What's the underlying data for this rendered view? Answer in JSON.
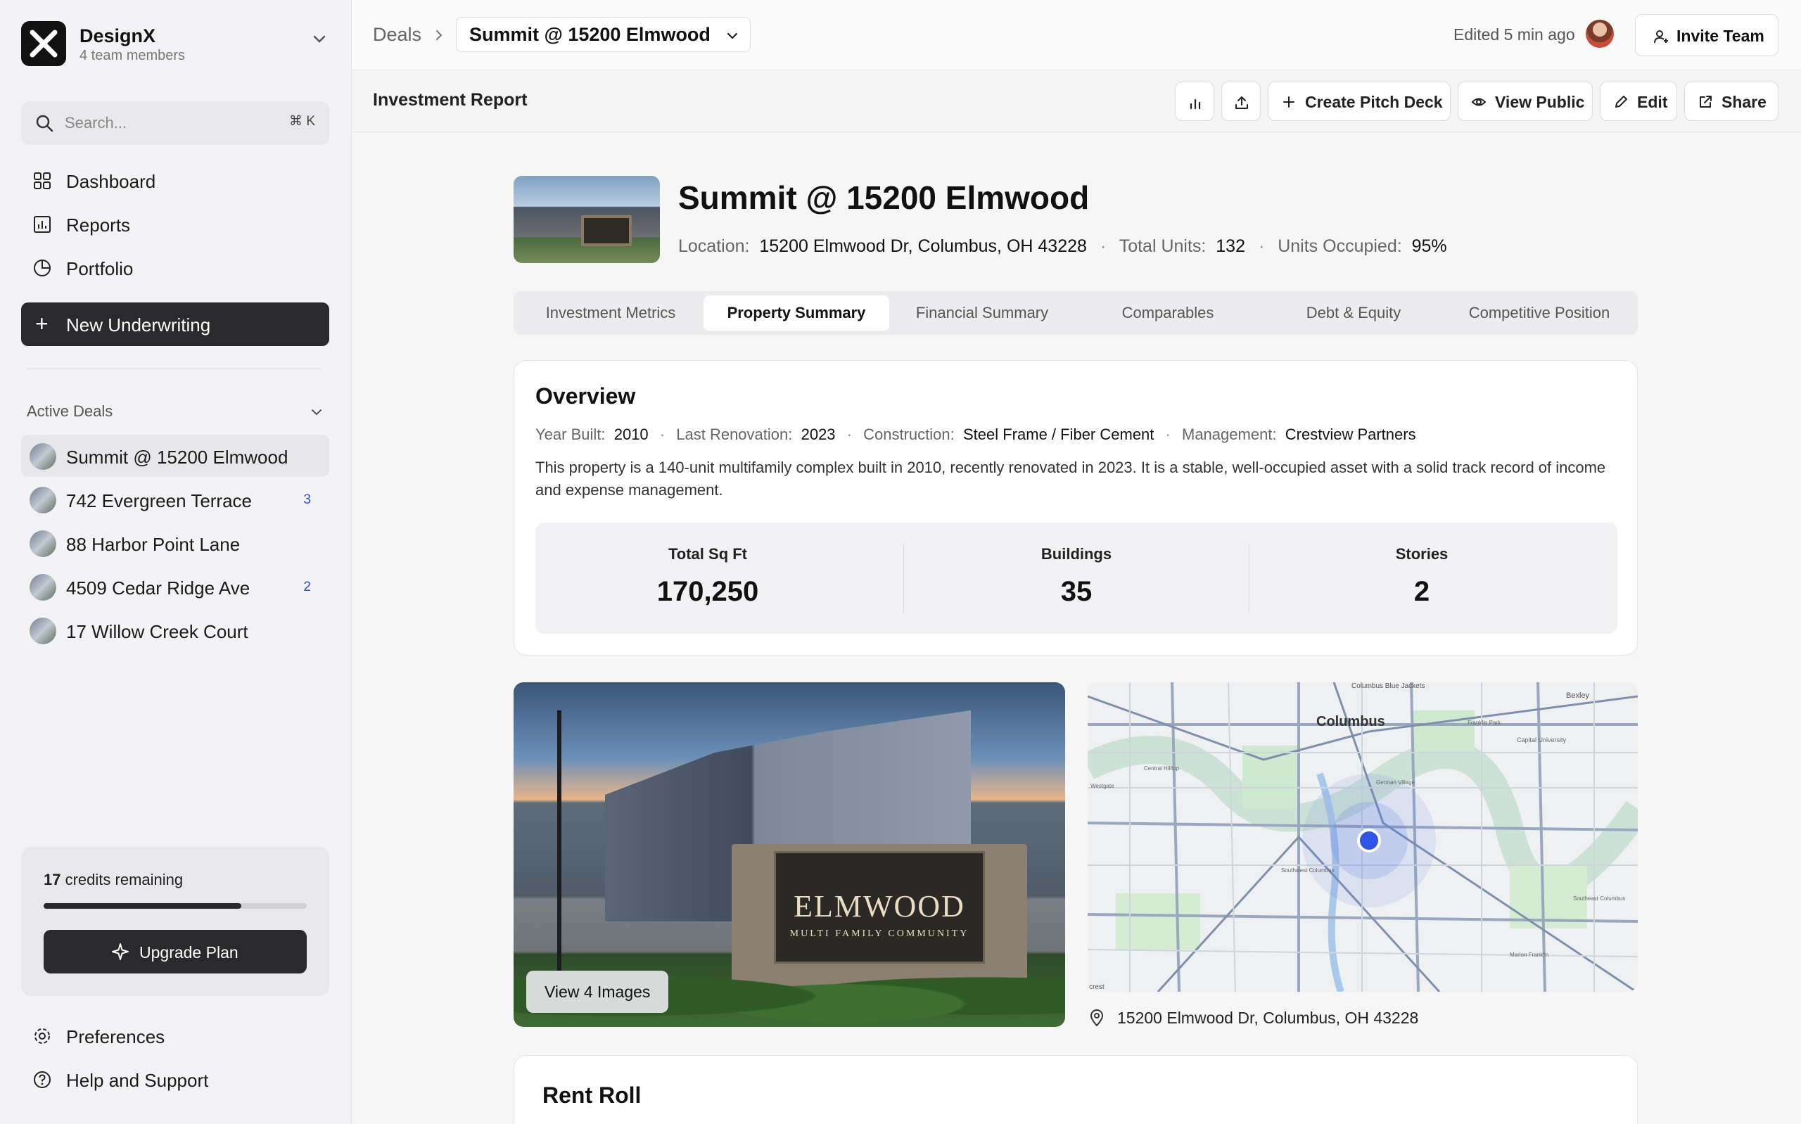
{
  "workspace": {
    "name": "DesignX",
    "members": "4 team members"
  },
  "search": {
    "placeholder": "Search...",
    "shortcut": "⌘ K"
  },
  "nav": [
    {
      "label": "Dashboard",
      "icon": "dashboard-icon"
    },
    {
      "label": "Reports",
      "icon": "reports-icon"
    },
    {
      "label": "Portfolio",
      "icon": "portfolio-icon"
    }
  ],
  "new_button": {
    "label": "New Underwriting"
  },
  "active_deals": {
    "header": "Active Deals",
    "items": [
      {
        "label": "Summit @ 15200 Elmwood",
        "badge": ""
      },
      {
        "label": "742 Evergreen Terrace",
        "badge": "3"
      },
      {
        "label": "88 Harbor Point Lane",
        "badge": ""
      },
      {
        "label": "4509 Cedar Ridge Ave",
        "badge": "2"
      },
      {
        "label": "17 Willow Creek Court",
        "badge": ""
      }
    ]
  },
  "credits": {
    "count": "17",
    "text": "credits remaining",
    "fraction": 0.75,
    "upgrade_label": "Upgrade Plan"
  },
  "footer_nav": [
    {
      "label": "Preferences"
    },
    {
      "label": "Help and Support"
    }
  ],
  "breadcrumb": {
    "root": "Deals",
    "current": "Summit @ 15200 Elmwood"
  },
  "edited": "Edited 5 min ago",
  "invite_label": "Invite Team",
  "subheader": {
    "title": "Investment Report",
    "buttons": {
      "create": "Create Pitch Deck",
      "view": "View Public",
      "edit": "Edit",
      "share": "Share"
    }
  },
  "property": {
    "title": "Summit @ 15200 Elmwood",
    "location_label": "Location:",
    "location": "15200 Elmwood Dr, Columbus, OH 43228",
    "units_label": "Total Units:",
    "units": "132",
    "occupied_label": "Units Occupied:",
    "occupied": "95%"
  },
  "tabs": [
    "Investment Metrics",
    "Property Summary",
    "Financial Summary",
    "Comparables",
    "Debt & Equity",
    "Competitive Position"
  ],
  "overview": {
    "title": "Overview",
    "year_label": "Year Built:",
    "year": "2010",
    "renovation_label": "Last Renovation:",
    "renovation": "2023",
    "construction_label": "Construction:",
    "construction": "Steel Frame / Fiber Cement",
    "management_label": "Management:",
    "management": "Crestview Partners",
    "description": "This property is a 140-unit multifamily complex built in 2010, recently renovated in 2023. It is a stable, well-occupied asset with a solid track record of income and expense management.",
    "stats": [
      {
        "label": "Total Sq Ft",
        "value": "170,250"
      },
      {
        "label": "Buildings",
        "value": "35"
      },
      {
        "label": "Stories",
        "value": "2"
      }
    ]
  },
  "photo": {
    "sign_main": "ELMWOOD",
    "sign_sub": "MULTI FAMILY COMMUNITY",
    "view_label": "View 4 Images"
  },
  "map": {
    "city": "Columbus",
    "labels": [
      "Columbus Blue Jackets",
      "Bexley",
      "Franklin Park",
      "Capital University",
      "Central Hilltop",
      "Westgate",
      "German Village",
      "Southwest Columbus",
      "Southeast Columbus",
      "Marion Franklin",
      "crest"
    ],
    "address": "15200 Elmwood Dr, Columbus, OH 43228"
  },
  "rent_roll": {
    "title": "Rent Roll"
  },
  "colors": {
    "accent": "#2b4fe0",
    "dark": "#2a2a2c",
    "map_pin": "#2f55e6"
  }
}
